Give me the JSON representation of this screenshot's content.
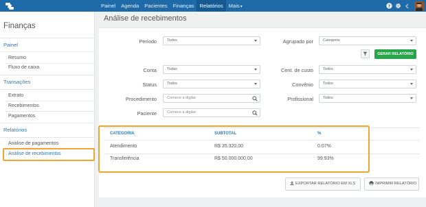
{
  "nav": {
    "items": [
      "Painel",
      "Agenda",
      "Pacientes",
      "Finanças",
      "Relatórios",
      "Mais"
    ],
    "active_index": 4
  },
  "sidebar": {
    "title": "Finanças",
    "sections": [
      {
        "label": "Painel",
        "items": [
          "Resumo",
          "Fluxo de caixa"
        ]
      },
      {
        "label": "Transações",
        "items": [
          "Extrato",
          "Recebimentos",
          "Pagamentos"
        ]
      },
      {
        "label": "Relatórios",
        "items": [
          "Análise de pagamentos",
          "Análise de recebimentos"
        ]
      }
    ],
    "active_item": "Análise de recebimentos"
  },
  "page": {
    "title": "Análise de recebimentos"
  },
  "filters": {
    "periodo": {
      "label": "Período",
      "value": "Todos"
    },
    "agrupado": {
      "label": "Agrupado por",
      "value": "Categoria"
    },
    "conta": {
      "label": "Conta",
      "value": "Todas"
    },
    "centro": {
      "label": "Cent. de custo",
      "value": "Todos"
    },
    "status": {
      "label": "Status",
      "value": "Todos"
    },
    "convenio": {
      "label": "Convênio",
      "value": "Todos"
    },
    "procedimento": {
      "label": "Procedimento",
      "placeholder": "Comece a digitar"
    },
    "profissional": {
      "label": "Profissional",
      "value": "Todos"
    },
    "paciente": {
      "label": "Paciente",
      "placeholder": "Comece a digitar"
    }
  },
  "buttons": {
    "generate": "GERAR RELATÓRIO",
    "export": "EXPORTAR RELATÓRIO EM XLS",
    "print": "IMPRIMIR RELATÓRIO"
  },
  "table": {
    "columns": [
      "CATEGORIA",
      "SUBTOTAL",
      "%"
    ],
    "rows": [
      [
        "Atendimento",
        "R$ 35.320,00",
        "0.07%"
      ],
      [
        "Transferência",
        "R$ 50.000.000,00",
        "99.93%"
      ]
    ]
  },
  "colors": {
    "nav": "#1f6aa8",
    "accent": "#2b78bf",
    "primary_button": "#26a54a",
    "highlight": "#f0a530"
  }
}
